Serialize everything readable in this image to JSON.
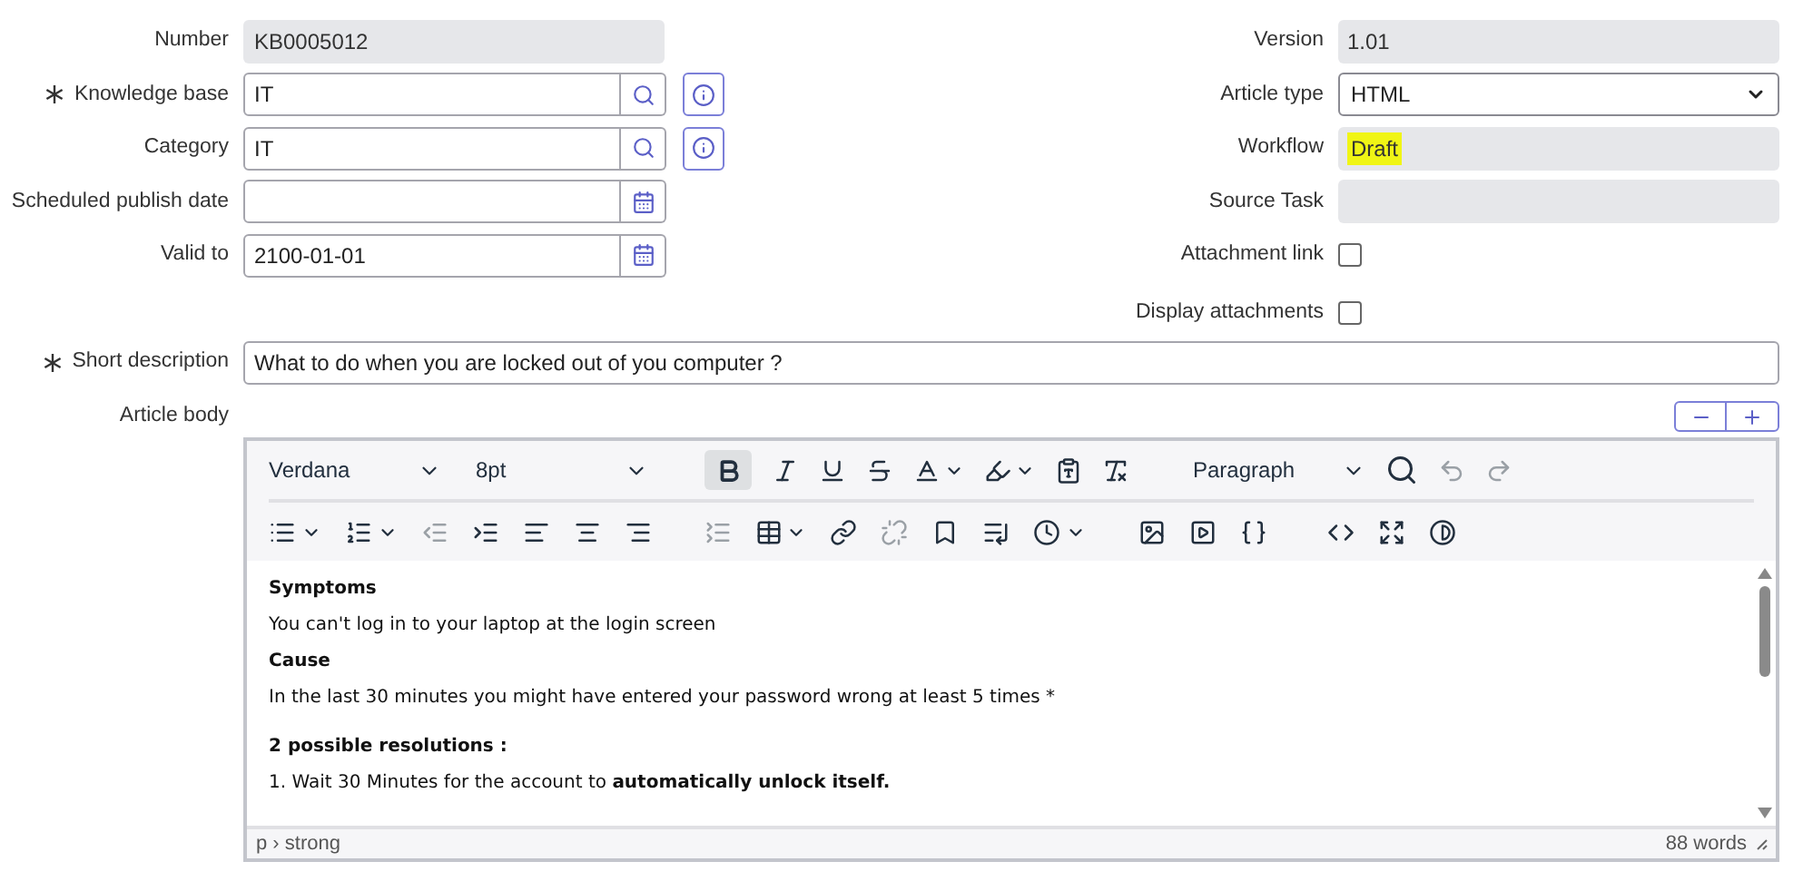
{
  "left_fields": [
    {
      "kind": "readonly",
      "label": "Number",
      "required": false,
      "value": "KB0005012"
    },
    {
      "kind": "reference",
      "label": "Knowledge base",
      "required": true,
      "value": "IT"
    },
    {
      "kind": "reference",
      "label": "Category",
      "required": false,
      "value": "IT"
    },
    {
      "kind": "date",
      "label": "Scheduled publish date",
      "required": false
    },
    {
      "kind": "date",
      "label": "Valid to",
      "required": false,
      "value": "2100-01-01"
    }
  ],
  "right_fields": [
    {
      "kind": "readonly",
      "label": "Version",
      "value": "1.01"
    },
    {
      "kind": "select",
      "label": "Article type",
      "value": "HTML"
    },
    {
      "kind": "readonly",
      "label": "Workflow",
      "value": "Draft",
      "highlighted": true
    },
    {
      "kind": "readonly",
      "label": "Source Task"
    },
    {
      "kind": "checkbox",
      "label": "Attachment link",
      "checked": false
    },
    {
      "kind": "checkbox",
      "label": "Display attachments",
      "checked": false
    }
  ],
  "short_description": {
    "label": "Short description",
    "required": true,
    "value": "What to do when you are locked out of you computer ?"
  },
  "article_body": {
    "label": "Article body",
    "editor": {
      "font": "Verdana",
      "size": "8pt",
      "block": "Paragraph",
      "bold_selected": true,
      "content": [
        {
          "kind": "heading",
          "text": "Symptoms"
        },
        {
          "kind": "text",
          "text": "You can't log in to your laptop at the login screen"
        },
        {
          "kind": "heading",
          "text": "Cause"
        },
        {
          "kind": "text",
          "text": "In the last 30 minutes you might have entered your password wrong at least 5 times *"
        },
        {
          "kind": "section",
          "text": "2 possible resolutions :"
        },
        {
          "kind": "text",
          "text": "1. Wait 30 Minutes for the account to **automatically unlock itself.**"
        }
      ],
      "path": "p › strong",
      "word_count": "88 words"
    }
  }
}
